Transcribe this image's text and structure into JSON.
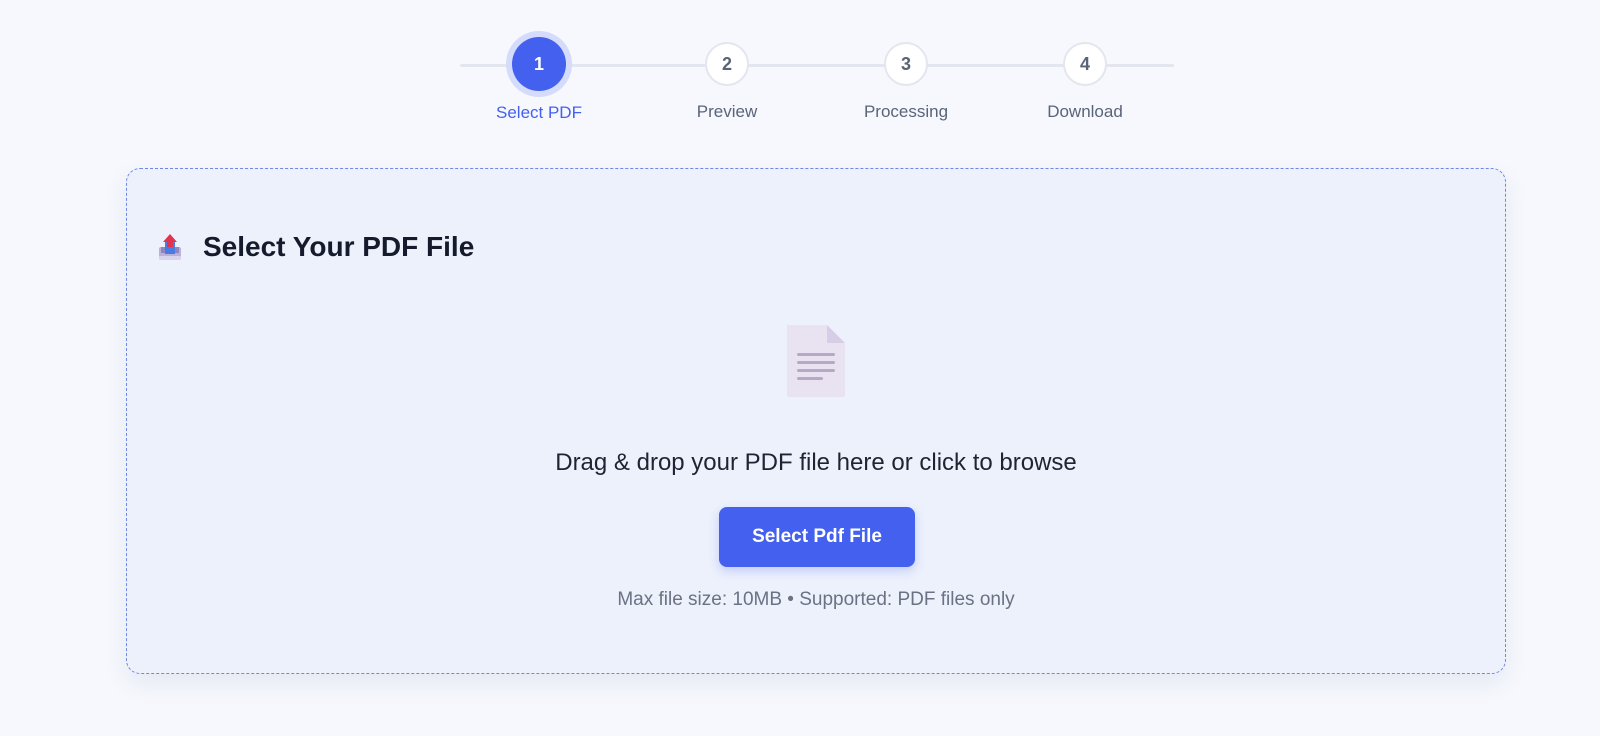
{
  "stepper": {
    "steps": [
      {
        "number": "1",
        "label": "Select PDF",
        "active": true
      },
      {
        "number": "2",
        "label": "Preview",
        "active": false
      },
      {
        "number": "3",
        "label": "Processing",
        "active": false
      },
      {
        "number": "4",
        "label": "Download",
        "active": false
      }
    ],
    "active_color": "#4361ee"
  },
  "upload_card": {
    "header_icon": "upload-tray-icon",
    "title": "Select Your PDF File",
    "file_icon": "document-icon",
    "drop_text": "Drag & drop your PDF file here or click to browse",
    "button_label": "Select Pdf File",
    "hint": "Max file size: 10MB • Supported: PDF files only"
  },
  "colors": {
    "accent": "#4361ee",
    "background": "#f6f8fd",
    "card_background": "#edf1fc"
  }
}
